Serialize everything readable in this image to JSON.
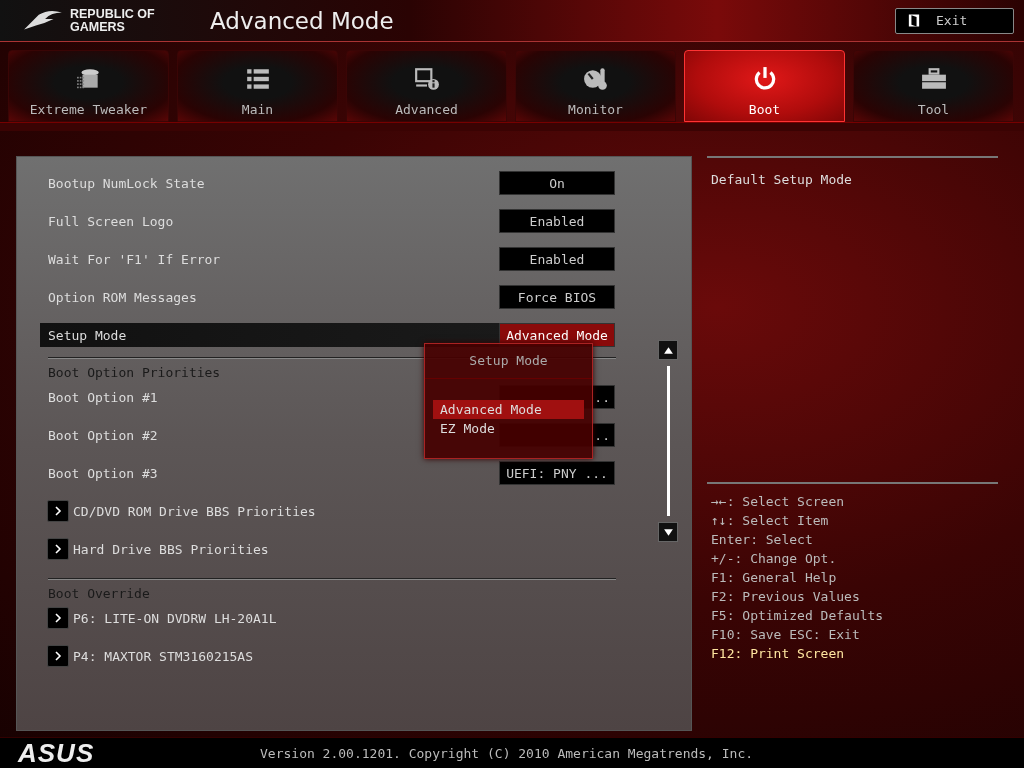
{
  "header": {
    "logo_text": [
      "REPUBLIC OF",
      "GAMERS"
    ],
    "title": "Advanced Mode",
    "exit_button": "Exit"
  },
  "tabs": [
    {
      "label": "Extreme Tweaker",
      "kind": "tweaker",
      "selected": false
    },
    {
      "label": "Main",
      "kind": "main",
      "selected": false
    },
    {
      "label": "Advanced",
      "kind": "advanced",
      "selected": false
    },
    {
      "label": "Monitor",
      "kind": "monitor",
      "selected": false
    },
    {
      "label": "Boot",
      "kind": "boot",
      "selected": true
    },
    {
      "label": "Tool",
      "kind": "tool",
      "selected": false
    }
  ],
  "sections": [
    {
      "items": [
        {
          "kind": "setting",
          "label": "Bootup NumLock State",
          "value": "On",
          "selected": false
        },
        {
          "kind": "setting",
          "label": "Full Screen Logo",
          "value": "Enabled",
          "selected": false
        },
        {
          "kind": "setting",
          "label": "Wait For 'F1' If Error",
          "value": "Enabled",
          "selected": false
        },
        {
          "kind": "setting",
          "label": "Option ROM Messages",
          "value": "Force BIOS",
          "selected": false
        },
        {
          "kind": "setting",
          "label": "Setup Mode",
          "value": "Advanced Mode",
          "selected": true
        }
      ]
    },
    {
      "heading": "Boot Option Priorities",
      "items": [
        {
          "kind": "setting",
          "label": "Boot Option #1",
          "value": "..",
          "selected": false,
          "covered": true
        },
        {
          "kind": "setting",
          "label": "Boot Option #2",
          "value": "..",
          "selected": false,
          "covered": true
        },
        {
          "kind": "setting",
          "label": "Boot Option #3",
          "value": "UEFI: PNY ...",
          "selected": false
        },
        {
          "kind": "submenu",
          "label": "CD/DVD ROM Drive BBS Priorities"
        },
        {
          "kind": "submenu",
          "label": "Hard Drive BBS Priorities"
        }
      ]
    },
    {
      "heading": "Boot Override",
      "items": [
        {
          "kind": "submenu",
          "label": "P6: LITE-ON DVDRW LH-20A1L"
        },
        {
          "kind": "submenu",
          "label": "P4: MAXTOR STM3160215AS"
        }
      ]
    }
  ],
  "popup": {
    "title": "Setup Mode",
    "options": [
      {
        "label": "Advanced Mode",
        "selected": true
      },
      {
        "label": "EZ Mode",
        "selected": false
      }
    ]
  },
  "help": {
    "description": "Default Setup Mode",
    "keys": [
      {
        "text": "→←: Select Screen",
        "highlight": false
      },
      {
        "text": "↑↓: Select Item",
        "highlight": false
      },
      {
        "text": "Enter: Select",
        "highlight": false
      },
      {
        "text": "+/-: Change Opt.",
        "highlight": false
      },
      {
        "text": "F1: General Help",
        "highlight": false
      },
      {
        "text": "F2: Previous Values",
        "highlight": false
      },
      {
        "text": "F5: Optimized Defaults",
        "highlight": false
      },
      {
        "text": "F10: Save  ESC: Exit",
        "highlight": false
      },
      {
        "text": "F12: Print Screen",
        "highlight": true
      }
    ]
  },
  "footer": {
    "brand": "ASUS",
    "version": "Version 2.00.1201. Copyright (C) 2010 American Megatrends, Inc."
  }
}
